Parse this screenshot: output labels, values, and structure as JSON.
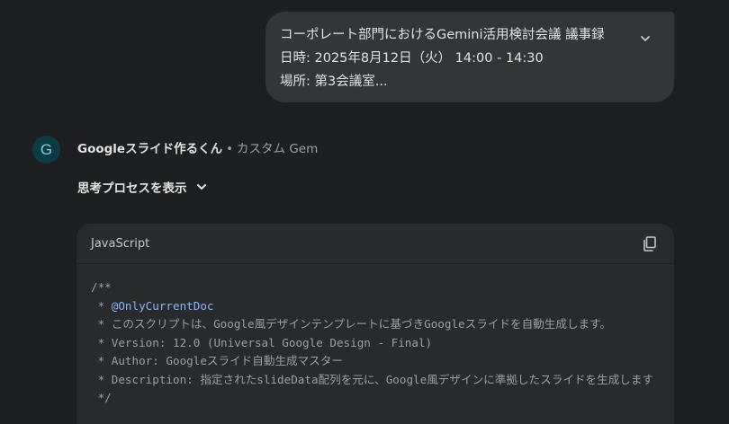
{
  "user_message": {
    "lines": [
      "コーポレート部門におけるGemini活用検討会議 議事録",
      "日時: 2025年8月12日（火） 14:00 - 14:30",
      "場所: 第3会議室..."
    ],
    "expand_icon": "chevron-down-icon"
  },
  "response": {
    "avatar_letter": "G",
    "gem_name": "Googleスライド作るくん",
    "separator": "•",
    "gem_type": "カスタム Gem",
    "show_thinking_label": "思考プロセスを表示",
    "show_thinking_icon": "chevron-down-icon"
  },
  "code_block": {
    "language": "JavaScript",
    "copy_icon": "copy-icon",
    "lines": {
      "l0": "/**",
      "l1_prefix": " * ",
      "l1_tag": "@OnlyCurrentDoc",
      "l2": " * このスクリプトは、Google風デザインテンプレートに基づきGoogleスライドを自動生成します。",
      "l3": " * Version: 12.0 (Universal Google Design - Final)",
      "l4": " * Author: Googleスライド自動生成マスター",
      "l5": " * Description: 指定されたslideData配列を元に、Google風デザインに準拠したスライドを生成します",
      "l6": " */"
    }
  },
  "colors": {
    "background": "#1e1f20",
    "bubble": "#333537",
    "code_bg": "#282a2c",
    "comment": "#9aa0a6",
    "doc_tag": "#8ab4f8",
    "avatar_bg": "#0b3b44"
  }
}
